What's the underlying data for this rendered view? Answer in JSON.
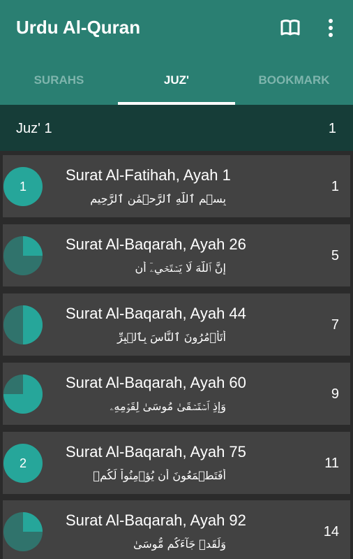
{
  "app": {
    "title": "Urdu Al-Quran"
  },
  "toolbar": {
    "book_icon": "book-open-icon",
    "more_icon": "more-vert-icon"
  },
  "tabs": [
    {
      "label": "SURAHS",
      "active": false
    },
    {
      "label": "JUZ'",
      "active": true
    },
    {
      "label": "BOOKMARK",
      "active": false
    }
  ],
  "colors": {
    "primary": "#2a7f72",
    "primary_dark": "#163d38",
    "accent": "#26a69a",
    "pie_dark": "#30736c",
    "card_bg": "#424242",
    "page_bg": "#2b2b2b"
  },
  "juz_header": {
    "title": "Juz' 1",
    "page": "1"
  },
  "items": [
    {
      "title": "Surat Al-Fatihah, Ayah 1",
      "arabic": "بِسۡمِ ٱللَّهِ ٱلرَّحۡمَٰنِ ٱلرَّحِيمِ",
      "page": "1",
      "badge": "1",
      "progress": 1.0
    },
    {
      "title": "Surat Al-Baqarah, Ayah 26",
      "arabic": "إِنَّ ٱللَّهَ لَا يَسۡتَحۡيِۦٓ أَن",
      "page": "5",
      "badge": "",
      "progress": 0.25
    },
    {
      "title": "Surat Al-Baqarah, Ayah 44",
      "arabic": "أَتَأۡمُرُونَ ٱلنَّاسَ بِٱلۡبِرِّ",
      "page": "7",
      "badge": "",
      "progress": 0.5
    },
    {
      "title": "Surat Al-Baqarah, Ayah 60",
      "arabic": "وَإِذِ ٱسۡتَسۡقَىٰ مُوسَىٰ لِقَوۡمِهِۦ",
      "page": "9",
      "badge": "",
      "progress": 0.75
    },
    {
      "title": "Surat Al-Baqarah, Ayah 75",
      "arabic": "أَفَتَطۡمَعُونَ أَن يُؤۡمِنُواْ لَكُمۡ",
      "page": "11",
      "badge": "2",
      "progress": 1.0
    },
    {
      "title": "Surat Al-Baqarah, Ayah 92",
      "arabic": "وَلَقَدۡ جَآءَكُم مُّوسَىٰ",
      "page": "14",
      "badge": "",
      "progress": 0.25
    }
  ]
}
